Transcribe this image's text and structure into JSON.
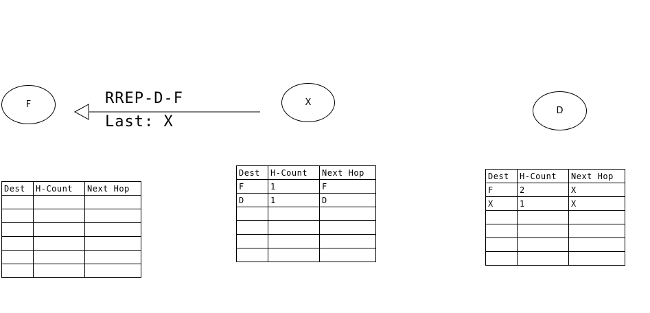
{
  "nodes": {
    "f": "F",
    "x": "X",
    "d": "D"
  },
  "message": {
    "type": "RREP-D-F",
    "last": "Last: X"
  },
  "tables": {
    "headers": [
      "Dest",
      "H-Count",
      "Next Hop"
    ],
    "f": {
      "rows": [
        [
          "",
          "",
          ""
        ],
        [
          "",
          "",
          ""
        ],
        [
          "",
          "",
          ""
        ],
        [
          "",
          "",
          ""
        ],
        [
          "",
          "",
          ""
        ],
        [
          "",
          "",
          ""
        ]
      ]
    },
    "x": {
      "rows": [
        [
          "F",
          "1",
          "F"
        ],
        [
          "D",
          "1",
          "D"
        ],
        [
          "",
          "",
          ""
        ],
        [
          "",
          "",
          ""
        ],
        [
          "",
          "",
          ""
        ],
        [
          "",
          "",
          ""
        ]
      ]
    },
    "d": {
      "rows": [
        [
          "F",
          "2",
          "X"
        ],
        [
          "X",
          "1",
          "X"
        ],
        [
          "",
          "",
          ""
        ],
        [
          "",
          "",
          ""
        ],
        [
          "",
          "",
          ""
        ],
        [
          "",
          "",
          ""
        ]
      ]
    }
  }
}
